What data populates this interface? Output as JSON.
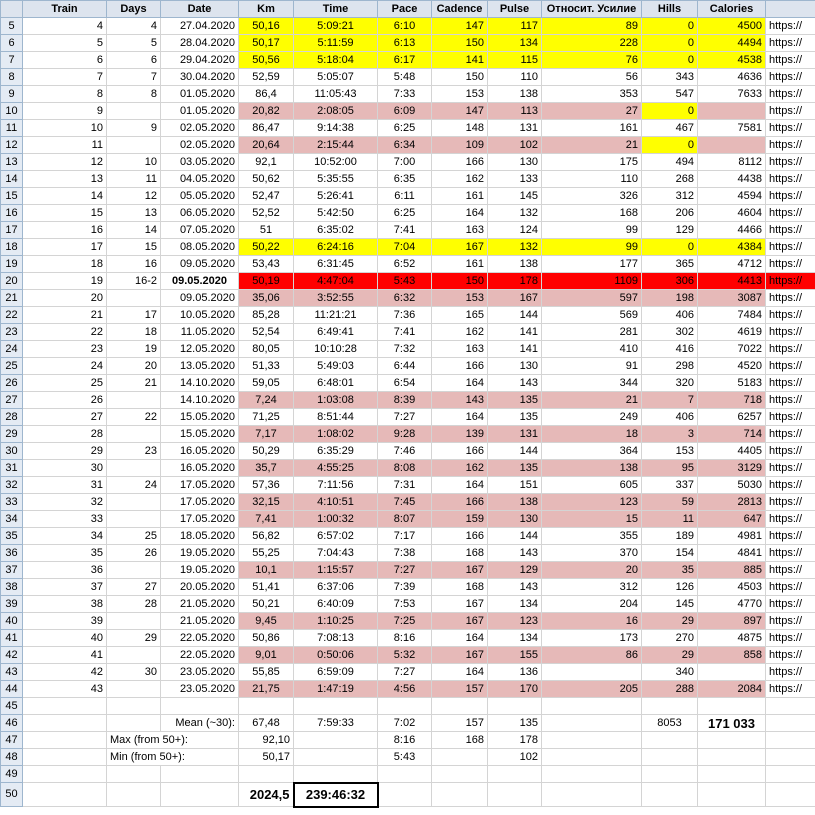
{
  "headers": [
    "Train",
    "Days",
    "Date",
    "Km",
    "Time",
    "Pace",
    "Cadence",
    "Pulse",
    "Относит. Усилие",
    "Hills",
    "Calories",
    ""
  ],
  "rows": [
    {
      "n": "5",
      "c": [
        "4",
        "4",
        "27.04.2020",
        "50,16",
        "5:09:21",
        "6:10",
        "147",
        "117",
        "89",
        "0",
        "4500",
        "https://"
      ],
      "hl": "yellow",
      "hl_to": 11
    },
    {
      "n": "6",
      "c": [
        "5",
        "5",
        "28.04.2020",
        "50,17",
        "5:11:59",
        "6:13",
        "150",
        "134",
        "228",
        "0",
        "4494",
        "https://"
      ],
      "hl": "yellow",
      "hl_to": 11
    },
    {
      "n": "7",
      "c": [
        "6",
        "6",
        "29.04.2020",
        "50,56",
        "5:18:04",
        "6:17",
        "141",
        "115",
        "76",
        "0",
        "4538",
        "https://"
      ],
      "hl": "yellow",
      "hl_to": 11
    },
    {
      "n": "8",
      "c": [
        "7",
        "7",
        "30.04.2020",
        "52,59",
        "5:05:07",
        "5:48",
        "150",
        "110",
        "56",
        "343",
        "4636",
        "https://"
      ]
    },
    {
      "n": "9",
      "c": [
        "8",
        "8",
        "01.05.2020",
        "86,4",
        "11:05:43",
        "7:33",
        "153",
        "138",
        "353",
        "547",
        "7633",
        "https://"
      ]
    },
    {
      "n": "10",
      "c": [
        "9",
        "",
        "01.05.2020",
        "20,82",
        "2:08:05",
        "6:09",
        "147",
        "113",
        "27",
        "0",
        "",
        "https://"
      ],
      "hl": "pink",
      "hl_to": 11,
      "yellow_cells": [
        9
      ]
    },
    {
      "n": "11",
      "c": [
        "10",
        "9",
        "02.05.2020",
        "86,47",
        "9:14:38",
        "6:25",
        "148",
        "131",
        "161",
        "467",
        "7581",
        "https://"
      ]
    },
    {
      "n": "12",
      "c": [
        "11",
        "",
        "02.05.2020",
        "20,64",
        "2:15:44",
        "6:34",
        "109",
        "102",
        "21",
        "0",
        "",
        "https://"
      ],
      "hl": "pink",
      "hl_to": 11,
      "yellow_cells": [
        9
      ]
    },
    {
      "n": "13",
      "c": [
        "12",
        "10",
        "03.05.2020",
        "92,1",
        "10:52:00",
        "7:00",
        "166",
        "130",
        "175",
        "494",
        "8112",
        "https://"
      ]
    },
    {
      "n": "14",
      "c": [
        "13",
        "11",
        "04.05.2020",
        "50,62",
        "5:35:55",
        "6:35",
        "162",
        "133",
        "110",
        "268",
        "4438",
        "https://"
      ]
    },
    {
      "n": "15",
      "c": [
        "14",
        "12",
        "05.05.2020",
        "52,47",
        "5:26:41",
        "6:11",
        "161",
        "145",
        "326",
        "312",
        "4594",
        "https://"
      ]
    },
    {
      "n": "16",
      "c": [
        "15",
        "13",
        "06.05.2020",
        "52,52",
        "5:42:50",
        "6:25",
        "164",
        "132",
        "168",
        "206",
        "4604",
        "https://"
      ]
    },
    {
      "n": "17",
      "c": [
        "16",
        "14",
        "07.05.2020",
        "51",
        "6:35:02",
        "7:41",
        "163",
        "124",
        "99",
        "129",
        "4466",
        "https://"
      ]
    },
    {
      "n": "18",
      "c": [
        "17",
        "15",
        "08.05.2020",
        "50,22",
        "6:24:16",
        "7:04",
        "167",
        "132",
        "99",
        "0",
        "4384",
        "https://"
      ],
      "hl": "yellow",
      "hl_to": 11
    },
    {
      "n": "19",
      "c": [
        "18",
        "16",
        "09.05.2020",
        "53,43",
        "6:31:45",
        "6:52",
        "161",
        "138",
        "177",
        "365",
        "4712",
        "https://"
      ]
    },
    {
      "n": "20",
      "c": [
        "19",
        "16-2",
        "09.05.2020",
        "50,19",
        "4:47:04",
        "5:43",
        "150",
        "178",
        "1109",
        "306",
        "4413",
        "https://"
      ],
      "hl": "red",
      "hl_to": 12,
      "bold_cells": [
        2
      ]
    },
    {
      "n": "21",
      "c": [
        "20",
        "",
        "09.05.2020",
        "35,06",
        "3:52:55",
        "6:32",
        "153",
        "167",
        "597",
        "198",
        "3087",
        "https://"
      ],
      "hl": "pink",
      "hl_to": 11
    },
    {
      "n": "22",
      "c": [
        "21",
        "17",
        "10.05.2020",
        "85,28",
        "11:21:21",
        "7:36",
        "165",
        "144",
        "569",
        "406",
        "7484",
        "https://"
      ]
    },
    {
      "n": "23",
      "c": [
        "22",
        "18",
        "11.05.2020",
        "52,54",
        "6:49:41",
        "7:41",
        "162",
        "141",
        "281",
        "302",
        "4619",
        "https://"
      ]
    },
    {
      "n": "24",
      "c": [
        "23",
        "19",
        "12.05.2020",
        "80,05",
        "10:10:28",
        "7:32",
        "163",
        "141",
        "410",
        "416",
        "7022",
        "https://"
      ]
    },
    {
      "n": "25",
      "c": [
        "24",
        "20",
        "13.05.2020",
        "51,33",
        "5:49:03",
        "6:44",
        "166",
        "130",
        "91",
        "298",
        "4520",
        "https://"
      ]
    },
    {
      "n": "26",
      "c": [
        "25",
        "21",
        "14.10.2020",
        "59,05",
        "6:48:01",
        "6:54",
        "164",
        "143",
        "344",
        "320",
        "5183",
        "https://"
      ]
    },
    {
      "n": "27",
      "c": [
        "26",
        "",
        "14.10.2020",
        "7,24",
        "1:03:08",
        "8:39",
        "143",
        "135",
        "21",
        "7",
        "718",
        "https://"
      ],
      "hl": "pink",
      "hl_to": 11
    },
    {
      "n": "28",
      "c": [
        "27",
        "22",
        "15.05.2020",
        "71,25",
        "8:51:44",
        "7:27",
        "164",
        "135",
        "249",
        "406",
        "6257",
        "https://"
      ]
    },
    {
      "n": "29",
      "c": [
        "28",
        "",
        "15.05.2020",
        "7,17",
        "1:08:02",
        "9:28",
        "139",
        "131",
        "18",
        "3",
        "714",
        "https://"
      ],
      "hl": "pink",
      "hl_to": 11
    },
    {
      "n": "30",
      "c": [
        "29",
        "23",
        "16.05.2020",
        "50,29",
        "6:35:29",
        "7:46",
        "166",
        "144",
        "364",
        "153",
        "4405",
        "https://"
      ]
    },
    {
      "n": "31",
      "c": [
        "30",
        "",
        "16.05.2020",
        "35,7",
        "4:55:25",
        "8:08",
        "162",
        "135",
        "138",
        "95",
        "3129",
        "https://"
      ],
      "hl": "pink",
      "hl_to": 11
    },
    {
      "n": "32",
      "c": [
        "31",
        "24",
        "17.05.2020",
        "57,36",
        "7:11:56",
        "7:31",
        "164",
        "151",
        "605",
        "337",
        "5030",
        "https://"
      ]
    },
    {
      "n": "33",
      "c": [
        "32",
        "",
        "17.05.2020",
        "32,15",
        "4:10:51",
        "7:45",
        "166",
        "138",
        "123",
        "59",
        "2813",
        "https://"
      ],
      "hl": "pink",
      "hl_to": 11
    },
    {
      "n": "34",
      "c": [
        "33",
        "",
        "17.05.2020",
        "7,41",
        "1:00:32",
        "8:07",
        "159",
        "130",
        "15",
        "11",
        "647",
        "https://"
      ],
      "hl": "pink",
      "hl_to": 11
    },
    {
      "n": "35",
      "c": [
        "34",
        "25",
        "18.05.2020",
        "56,82",
        "6:57:02",
        "7:17",
        "166",
        "144",
        "355",
        "189",
        "4981",
        "https://"
      ]
    },
    {
      "n": "36",
      "c": [
        "35",
        "26",
        "19.05.2020",
        "55,25",
        "7:04:43",
        "7:38",
        "168",
        "143",
        "370",
        "154",
        "4841",
        "https://"
      ]
    },
    {
      "n": "37",
      "c": [
        "36",
        "",
        "19.05.2020",
        "10,1",
        "1:15:57",
        "7:27",
        "167",
        "129",
        "20",
        "35",
        "885",
        "https://"
      ],
      "hl": "pink",
      "hl_to": 11
    },
    {
      "n": "38",
      "c": [
        "37",
        "27",
        "20.05.2020",
        "51,41",
        "6:37:06",
        "7:39",
        "168",
        "143",
        "312",
        "126",
        "4503",
        "https://"
      ]
    },
    {
      "n": "39",
      "c": [
        "38",
        "28",
        "21.05.2020",
        "50,21",
        "6:40:09",
        "7:53",
        "167",
        "134",
        "204",
        "145",
        "4770",
        "https://"
      ]
    },
    {
      "n": "40",
      "c": [
        "39",
        "",
        "21.05.2020",
        "9,45",
        "1:10:25",
        "7:25",
        "167",
        "123",
        "16",
        "29",
        "897",
        "https://"
      ],
      "hl": "pink",
      "hl_to": 11
    },
    {
      "n": "41",
      "c": [
        "40",
        "29",
        "22.05.2020",
        "50,86",
        "7:08:13",
        "8:16",
        "164",
        "134",
        "173",
        "270",
        "4875",
        "https://"
      ]
    },
    {
      "n": "42",
      "c": [
        "41",
        "",
        "22.05.2020",
        "9,01",
        "0:50:06",
        "5:32",
        "167",
        "155",
        "86",
        "29",
        "858",
        "https://"
      ],
      "hl": "pink",
      "hl_to": 11
    },
    {
      "n": "43",
      "c": [
        "42",
        "30",
        "23.05.2020",
        "55,85",
        "6:59:09",
        "7:27",
        "164",
        "136",
        "",
        "340",
        "",
        "https://"
      ]
    },
    {
      "n": "44",
      "c": [
        "43",
        "",
        "23.05.2020",
        "21,75",
        "1:47:19",
        "4:56",
        "157",
        "170",
        "205",
        "288",
        "2084",
        "https://"
      ],
      "hl": "pink",
      "hl_to": 11
    }
  ],
  "summary": {
    "r45": "45",
    "r46": {
      "n": "46",
      "label": "Mean (~30):",
      "km": "67,48",
      "time": "7:59:33",
      "pace": "7:02",
      "cadence": "157",
      "pulse": "135",
      "hills": "8053",
      "calories": "171 033"
    },
    "r47": {
      "n": "47",
      "label": "Max (from 50+):",
      "km": "92,10",
      "pace": "8:16",
      "cadence": "168",
      "pulse": "178"
    },
    "r48": {
      "n": "48",
      "label": "Min (from 50+):",
      "km": "50,17",
      "pace": "5:43",
      "pulse": "102"
    },
    "r49": "49",
    "r50": {
      "n": "50",
      "km": "2024,5",
      "time": "239:46:32"
    }
  }
}
